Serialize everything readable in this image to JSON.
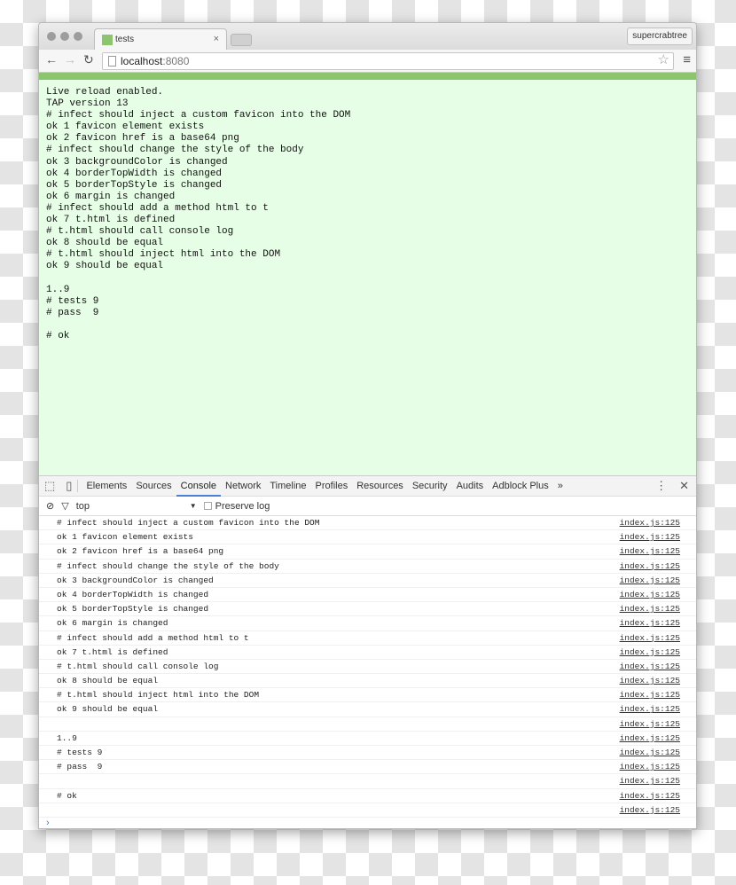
{
  "browser": {
    "tab_title": "tests",
    "user": "supercrabtree",
    "url_host": "localhost",
    "url_port": ":8080",
    "accent": "#8cc56d"
  },
  "page": {
    "lines": [
      "Live reload enabled.",
      "TAP version 13",
      "# infect should inject a custom favicon into the DOM",
      "ok 1 favicon element exists",
      "ok 2 favicon href is a base64 png",
      "# infect should change the style of the body",
      "ok 3 backgroundColor is changed",
      "ok 4 borderTopWidth is changed",
      "ok 5 borderTopStyle is changed",
      "ok 6 margin is changed",
      "# infect should add a method html to t",
      "ok 7 t.html is defined",
      "# t.html should call console log",
      "ok 8 should be equal",
      "# t.html should inject html into the DOM",
      "ok 9 should be equal",
      "",
      "1..9",
      "# tests 9",
      "# pass  9",
      "",
      "# ok"
    ]
  },
  "devtools": {
    "tabs": [
      "Elements",
      "Sources",
      "Console",
      "Network",
      "Timeline",
      "Profiles",
      "Resources",
      "Security",
      "Audits",
      "Adblock Plus"
    ],
    "active_tab": "Console",
    "more": "»",
    "context": "top",
    "preserve_log": "Preserve log",
    "rows": [
      {
        "text": "# infect should inject a custom favicon into the DOM",
        "src": "index.js:125"
      },
      {
        "text": "ok 1 favicon element exists",
        "src": "index.js:125"
      },
      {
        "text": "ok 2 favicon href is a base64 png",
        "src": "index.js:125"
      },
      {
        "text": "# infect should change the style of the body",
        "src": "index.js:125"
      },
      {
        "text": "ok 3 backgroundColor is changed",
        "src": "index.js:125"
      },
      {
        "text": "ok 4 borderTopWidth is changed",
        "src": "index.js:125"
      },
      {
        "text": "ok 5 borderTopStyle is changed",
        "src": "index.js:125"
      },
      {
        "text": "ok 6 margin is changed",
        "src": "index.js:125"
      },
      {
        "text": "# infect should add a method html to t",
        "src": "index.js:125"
      },
      {
        "text": "ok 7 t.html is defined",
        "src": "index.js:125"
      },
      {
        "text": "# t.html should call console log",
        "src": "index.js:125"
      },
      {
        "text": "ok 8 should be equal",
        "src": "index.js:125"
      },
      {
        "text": "# t.html should inject html into the DOM",
        "src": "index.js:125"
      },
      {
        "text": "ok 9 should be equal",
        "src": "index.js:125"
      },
      {
        "text": "",
        "src": "index.js:125"
      },
      {
        "text": "1..9",
        "src": "index.js:125"
      },
      {
        "text": "# tests 9",
        "src": "index.js:125"
      },
      {
        "text": "# pass  9",
        "src": "index.js:125"
      },
      {
        "text": "",
        "src": "index.js:125"
      },
      {
        "text": "# ok",
        "src": "index.js:125"
      },
      {
        "text": "",
        "src": "index.js:125"
      }
    ],
    "prompt": "›"
  }
}
